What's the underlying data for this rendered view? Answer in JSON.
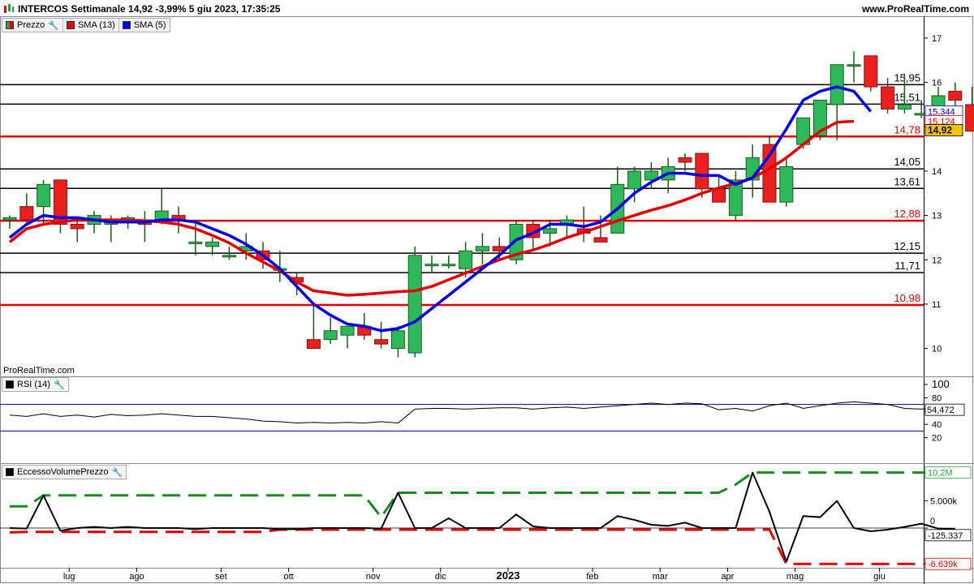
{
  "header": {
    "title": "INTERCOS Settimanale 14,92 -3,99% 5 giu 2023, 17:35:25",
    "site": "www.ProRealTime.com"
  },
  "price_panel": {
    "legend": [
      {
        "label": "Prezzo",
        "color": "#2e9e44",
        "icon": "wrench-icon"
      },
      {
        "label": "SMA (13)",
        "color": "#e00000"
      },
      {
        "label": "SMA (5)",
        "color": "#0000e0"
      }
    ],
    "watermark": "ProRealTime.com",
    "y_ticks": [
      "17",
      "16",
      "15",
      "14",
      "13",
      "12",
      "11",
      "10"
    ],
    "hlines": [
      {
        "value": 15.95,
        "label": "15,95",
        "color": "#000000"
      },
      {
        "value": 15.51,
        "label": "15,51",
        "color": "#000000"
      },
      {
        "value": 14.78,
        "label": "14,78",
        "color": "#e00000"
      },
      {
        "value": 14.05,
        "label": "14,05",
        "color": "#000000"
      },
      {
        "value": 13.61,
        "label": "13,61",
        "color": "#000000"
      },
      {
        "value": 12.88,
        "label": "12,88",
        "color": "#e00000"
      },
      {
        "value": 12.15,
        "label": "12,15",
        "color": "#000000"
      },
      {
        "value": 11.71,
        "label": "11,71",
        "color": "#000000"
      },
      {
        "value": 10.98,
        "label": "10,98",
        "color": "#e00000"
      }
    ],
    "tags": [
      {
        "label": "15,344",
        "value": 15.344,
        "color": "#0000e0",
        "bg": "#ffffff"
      },
      {
        "label": "15,124",
        "value": 15.124,
        "color": "#e00000",
        "bg": "#ffffff"
      },
      {
        "label": "14,92",
        "value": 14.92,
        "color": "#000000",
        "bg": "#f5c400"
      }
    ]
  },
  "rsi_panel": {
    "legend": [
      {
        "label": "RSI (14)",
        "color": "#000000",
        "icon": "wrench-icon"
      }
    ],
    "y_ticks": [
      "100",
      "80",
      "60",
      "40",
      "20"
    ],
    "tag": "54,472"
  },
  "volume_panel": {
    "legend": [
      {
        "label": "EccessoVolumePrezzo",
        "color": "#000000",
        "icon": "wrench-icon"
      }
    ],
    "y_ticks": [
      "5.000k",
      "0"
    ],
    "tags": [
      {
        "label": "10,2M",
        "color": "#2e9e44"
      },
      {
        "label": "-125.337",
        "color": "#000000"
      },
      {
        "label": "-6.639k",
        "color": "#e00000"
      }
    ]
  },
  "x_axis": {
    "labels": [
      {
        "label": "lug",
        "idx": 4
      },
      {
        "label": "ago",
        "idx": 8
      },
      {
        "label": "set",
        "idx": 13
      },
      {
        "label": "ott",
        "idx": 17
      },
      {
        "label": "nov",
        "idx": 22
      },
      {
        "label": "dic",
        "idx": 26
      },
      {
        "label": "2023",
        "idx": 30,
        "bold": true
      },
      {
        "label": "feb",
        "idx": 35
      },
      {
        "label": "mar",
        "idx": 39
      },
      {
        "label": "apr",
        "idx": 43
      },
      {
        "label": "mag",
        "idx": 47
      },
      {
        "label": "giu",
        "idx": 52
      }
    ]
  },
  "chart_data": [
    {
      "type": "candlestick",
      "title": "INTERCOS Settimanale",
      "ylim": [
        9.7,
        17.2
      ],
      "series": [
        {
          "name": "Prezzo",
          "ohlc": [
            [
              12.9,
              13.0,
              12.7,
              12.95
            ],
            [
              13.2,
              13.5,
              12.8,
              12.9
            ],
            [
              13.2,
              13.8,
              12.8,
              13.7
            ],
            [
              13.8,
              13.8,
              12.6,
              12.8
            ],
            [
              12.8,
              12.9,
              12.4,
              12.7
            ],
            [
              12.8,
              13.1,
              12.6,
              13.0
            ],
            [
              12.8,
              13.0,
              12.4,
              12.9
            ],
            [
              12.9,
              13.0,
              12.7,
              12.95
            ],
            [
              12.9,
              13.1,
              12.4,
              12.8
            ],
            [
              12.9,
              13.6,
              12.8,
              13.1
            ],
            [
              13.0,
              13.2,
              12.6,
              12.9
            ],
            [
              12.4,
              12.9,
              12.1,
              12.4
            ],
            [
              12.3,
              12.5,
              12.1,
              12.4
            ],
            [
              12.1,
              12.3,
              12.0,
              12.1
            ],
            [
              12.2,
              12.6,
              12.0,
              12.3
            ],
            [
              12.2,
              12.4,
              11.8,
              12.0
            ],
            [
              11.8,
              12.2,
              11.5,
              11.8
            ],
            [
              11.6,
              11.7,
              11.2,
              11.5
            ],
            [
              10.2,
              11.0,
              10.1,
              10.0
            ],
            [
              10.2,
              10.7,
              10.1,
              10.4
            ],
            [
              10.3,
              10.5,
              10.0,
              10.5
            ],
            [
              10.5,
              10.8,
              10.2,
              10.3
            ],
            [
              10.2,
              10.6,
              10.0,
              10.1
            ],
            [
              10.0,
              10.5,
              9.8,
              10.4
            ],
            [
              9.9,
              12.3,
              9.8,
              12.1
            ],
            [
              11.9,
              12.1,
              11.7,
              11.9
            ],
            [
              11.9,
              12.1,
              11.8,
              11.9
            ],
            [
              11.8,
              12.4,
              11.6,
              12.2
            ],
            [
              12.2,
              12.6,
              11.9,
              12.3
            ],
            [
              12.3,
              12.5,
              12.0,
              12.2
            ],
            [
              12.0,
              12.9,
              11.9,
              12.8
            ],
            [
              12.8,
              12.9,
              12.2,
              12.5
            ],
            [
              12.6,
              12.9,
              12.3,
              12.7
            ],
            [
              12.8,
              13.0,
              12.5,
              12.9
            ],
            [
              12.7,
              13.2,
              12.4,
              12.6
            ],
            [
              12.5,
              13.0,
              12.4,
              12.4
            ],
            [
              12.6,
              14.1,
              12.6,
              13.7
            ],
            [
              13.6,
              14.1,
              13.3,
              14.0
            ],
            [
              13.8,
              14.2,
              13.6,
              14.0
            ],
            [
              13.8,
              14.3,
              13.5,
              14.1
            ],
            [
              14.3,
              14.4,
              14.0,
              14.2
            ],
            [
              14.4,
              14.4,
              13.4,
              13.6
            ],
            [
              13.6,
              13.9,
              13.3,
              13.3
            ],
            [
              13.0,
              14.0,
              12.9,
              13.8
            ],
            [
              13.8,
              14.6,
              13.4,
              14.3
            ],
            [
              14.6,
              14.8,
              13.3,
              13.3
            ],
            [
              13.3,
              14.3,
              13.2,
              14.1
            ],
            [
              14.6,
              15.0,
              14.5,
              15.2
            ],
            [
              14.8,
              15.6,
              14.7,
              15.6
            ],
            [
              15.5,
              16.4,
              14.7,
              16.4
            ],
            [
              16.4,
              16.7,
              16.0,
              16.4
            ],
            [
              16.6,
              16.6,
              15.8,
              15.9
            ],
            [
              15.9,
              16.1,
              15.3,
              15.4
            ],
            [
              15.4,
              16.2,
              15.3,
              15.5
            ],
            [
              15.3,
              15.6,
              15.2,
              15.3
            ],
            [
              15.0,
              15.9,
              14.8,
              15.7
            ],
            [
              15.8,
              16.0,
              15.4,
              15.6
            ],
            [
              15.5,
              15.9,
              15.0,
              14.9
            ]
          ]
        },
        {
          "name": "SMA (13)",
          "values": [
            12.4,
            12.7,
            12.8,
            12.85,
            12.9,
            12.9,
            12.9,
            12.9,
            12.88,
            12.85,
            12.8,
            12.7,
            12.55,
            12.38,
            12.15,
            11.95,
            11.75,
            11.5,
            11.3,
            11.25,
            11.2,
            11.22,
            11.25,
            11.28,
            11.3,
            11.4,
            11.55,
            11.7,
            11.85,
            12.0,
            12.12,
            12.22,
            12.35,
            12.5,
            12.62,
            12.75,
            12.88,
            13.0,
            13.12,
            13.22,
            13.35,
            13.5,
            13.62,
            13.72,
            13.85,
            14.05,
            14.3,
            14.6,
            14.9,
            15.1,
            15.124
          ]
        },
        {
          "name": "SMA (5)",
          "values": [
            12.5,
            12.8,
            13.0,
            12.95,
            12.95,
            12.9,
            12.85,
            12.85,
            12.85,
            12.9,
            12.9,
            12.85,
            12.7,
            12.55,
            12.35,
            12.1,
            11.8,
            11.4,
            11.0,
            10.75,
            10.55,
            10.5,
            10.4,
            10.45,
            10.6,
            10.9,
            11.2,
            11.5,
            11.8,
            12.1,
            12.45,
            12.6,
            12.8,
            12.8,
            12.75,
            12.85,
            13.15,
            13.5,
            13.75,
            13.95,
            13.95,
            13.9,
            13.9,
            13.7,
            13.85,
            14.35,
            14.95,
            15.6,
            15.8,
            15.9,
            15.8,
            15.344
          ]
        }
      ]
    },
    {
      "type": "line",
      "title": "RSI (14)",
      "ylim": [
        0,
        100
      ],
      "series": [
        {
          "name": "RSI (14)",
          "values": [
            54,
            52,
            56,
            52,
            54,
            51,
            55,
            53,
            54,
            56,
            54,
            52,
            52,
            50,
            48,
            45,
            44,
            42,
            43,
            42,
            43,
            42,
            44,
            42,
            63,
            64,
            64,
            63,
            64,
            65,
            65,
            63,
            65,
            66,
            64,
            66,
            68,
            70,
            72,
            70,
            72,
            71,
            62,
            64,
            60,
            68,
            72,
            64,
            68,
            72,
            74,
            72,
            70,
            64,
            63,
            66,
            62
          ]
        },
        {
          "name": "overbought",
          "values": [
            70
          ]
        },
        {
          "name": "oversold",
          "values": [
            30
          ]
        }
      ]
    },
    {
      "type": "line",
      "title": "EccessoVolumePrezzo",
      "series": [
        {
          "name": "EccessoVolumePrezzo",
          "values": [
            0,
            -0.1,
            6,
            -0.5,
            0,
            0.2,
            0,
            0.2,
            0,
            0,
            0,
            -0.2,
            0,
            0,
            0,
            0,
            -0.2,
            -0.2,
            0,
            0,
            0,
            0,
            -0.1,
            6.5,
            0,
            0,
            1.8,
            0,
            0,
            0,
            2.5,
            0.3,
            0,
            0,
            0,
            0,
            2.2,
            1.5,
            0.6,
            0.4,
            1.0,
            0,
            0,
            0,
            10.2,
            3.0,
            -6.2,
            2.2,
            2.0,
            5.0,
            0,
            -0.6,
            -0.3,
            0.2,
            0.8,
            -0.1,
            -0.125
          ]
        },
        {
          "name": "upper",
          "values": [
            4.0,
            4.0,
            6.0,
            6.0,
            6.0,
            6.0,
            6.0,
            6.0,
            6.0,
            6.0,
            6.0,
            6.0,
            6.0,
            6.0,
            6.0,
            6.0,
            6.0,
            6.0,
            6.0,
            6.0,
            6.0,
            6.0,
            2.0,
            6.5,
            6.5,
            6.5,
            6.5,
            6.5,
            6.5,
            6.5,
            6.5,
            6.5,
            6.5,
            6.5,
            6.5,
            6.5,
            6.5,
            6.5,
            6.5,
            6.5,
            6.5,
            6.5,
            6.5,
            8.0,
            10.2,
            10.2,
            10.2,
            10.2,
            10.2,
            10.2,
            10.2,
            10.2,
            10.2,
            10.2,
            10.2,
            10.2,
            10.2
          ]
        },
        {
          "name": "lower",
          "values": [
            -0.8,
            -0.7,
            -0.7,
            -0.7,
            -0.7,
            -0.7,
            -0.7,
            -0.7,
            -0.7,
            -0.7,
            -0.7,
            -0.7,
            -0.7,
            -0.7,
            -0.7,
            -0.7,
            -0.3,
            -0.3,
            -0.3,
            -0.3,
            -0.3,
            -0.3,
            -0.3,
            -0.3,
            -0.3,
            -0.3,
            -0.3,
            -0.3,
            -0.3,
            -0.3,
            -0.3,
            -0.3,
            -0.3,
            -0.3,
            -0.3,
            -0.3,
            -0.3,
            -0.3,
            -0.3,
            -0.3,
            -0.3,
            -0.3,
            -0.3,
            -0.3,
            -0.3,
            -0.3,
            -6.6,
            -6.6,
            -6.6,
            -6.6,
            -6.6,
            -6.6,
            -6.6,
            -6.6,
            -6.6,
            -6.6,
            -6.6
          ]
        }
      ]
    }
  ]
}
